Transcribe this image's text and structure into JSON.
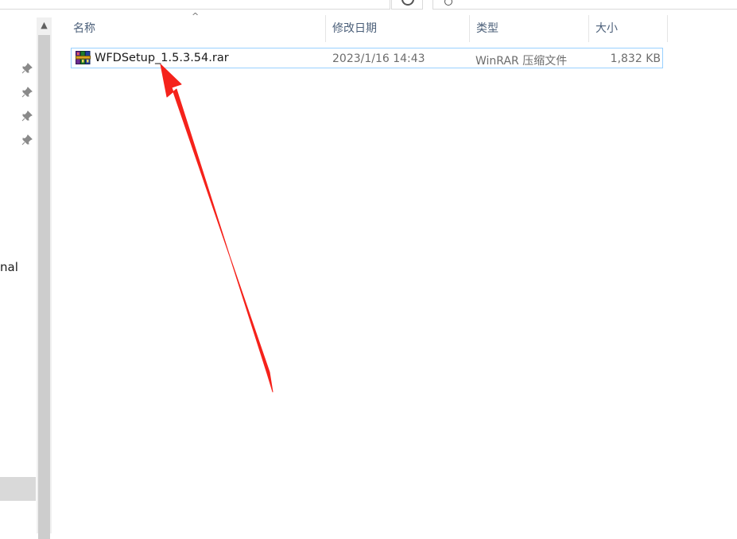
{
  "colors": {
    "header_text": "#4c607a",
    "secondary_text": "#6d6d6d",
    "selection_border": "#99d1ff",
    "annotation_arrow": "#f5221b"
  },
  "nav": {
    "partial_label": "nal",
    "pin_icon": "pin-icon"
  },
  "columns": {
    "name": "名称",
    "date_modified": "修改日期",
    "type": "类型",
    "size": "大小"
  },
  "files": [
    {
      "name": "WFDSetup_1.5.3.54.rar",
      "date_modified": "2023/1/16 14:43",
      "type": "WinRAR 压缩文件",
      "size": "1,832 KB",
      "icon": "winrar-archive-icon"
    }
  ]
}
